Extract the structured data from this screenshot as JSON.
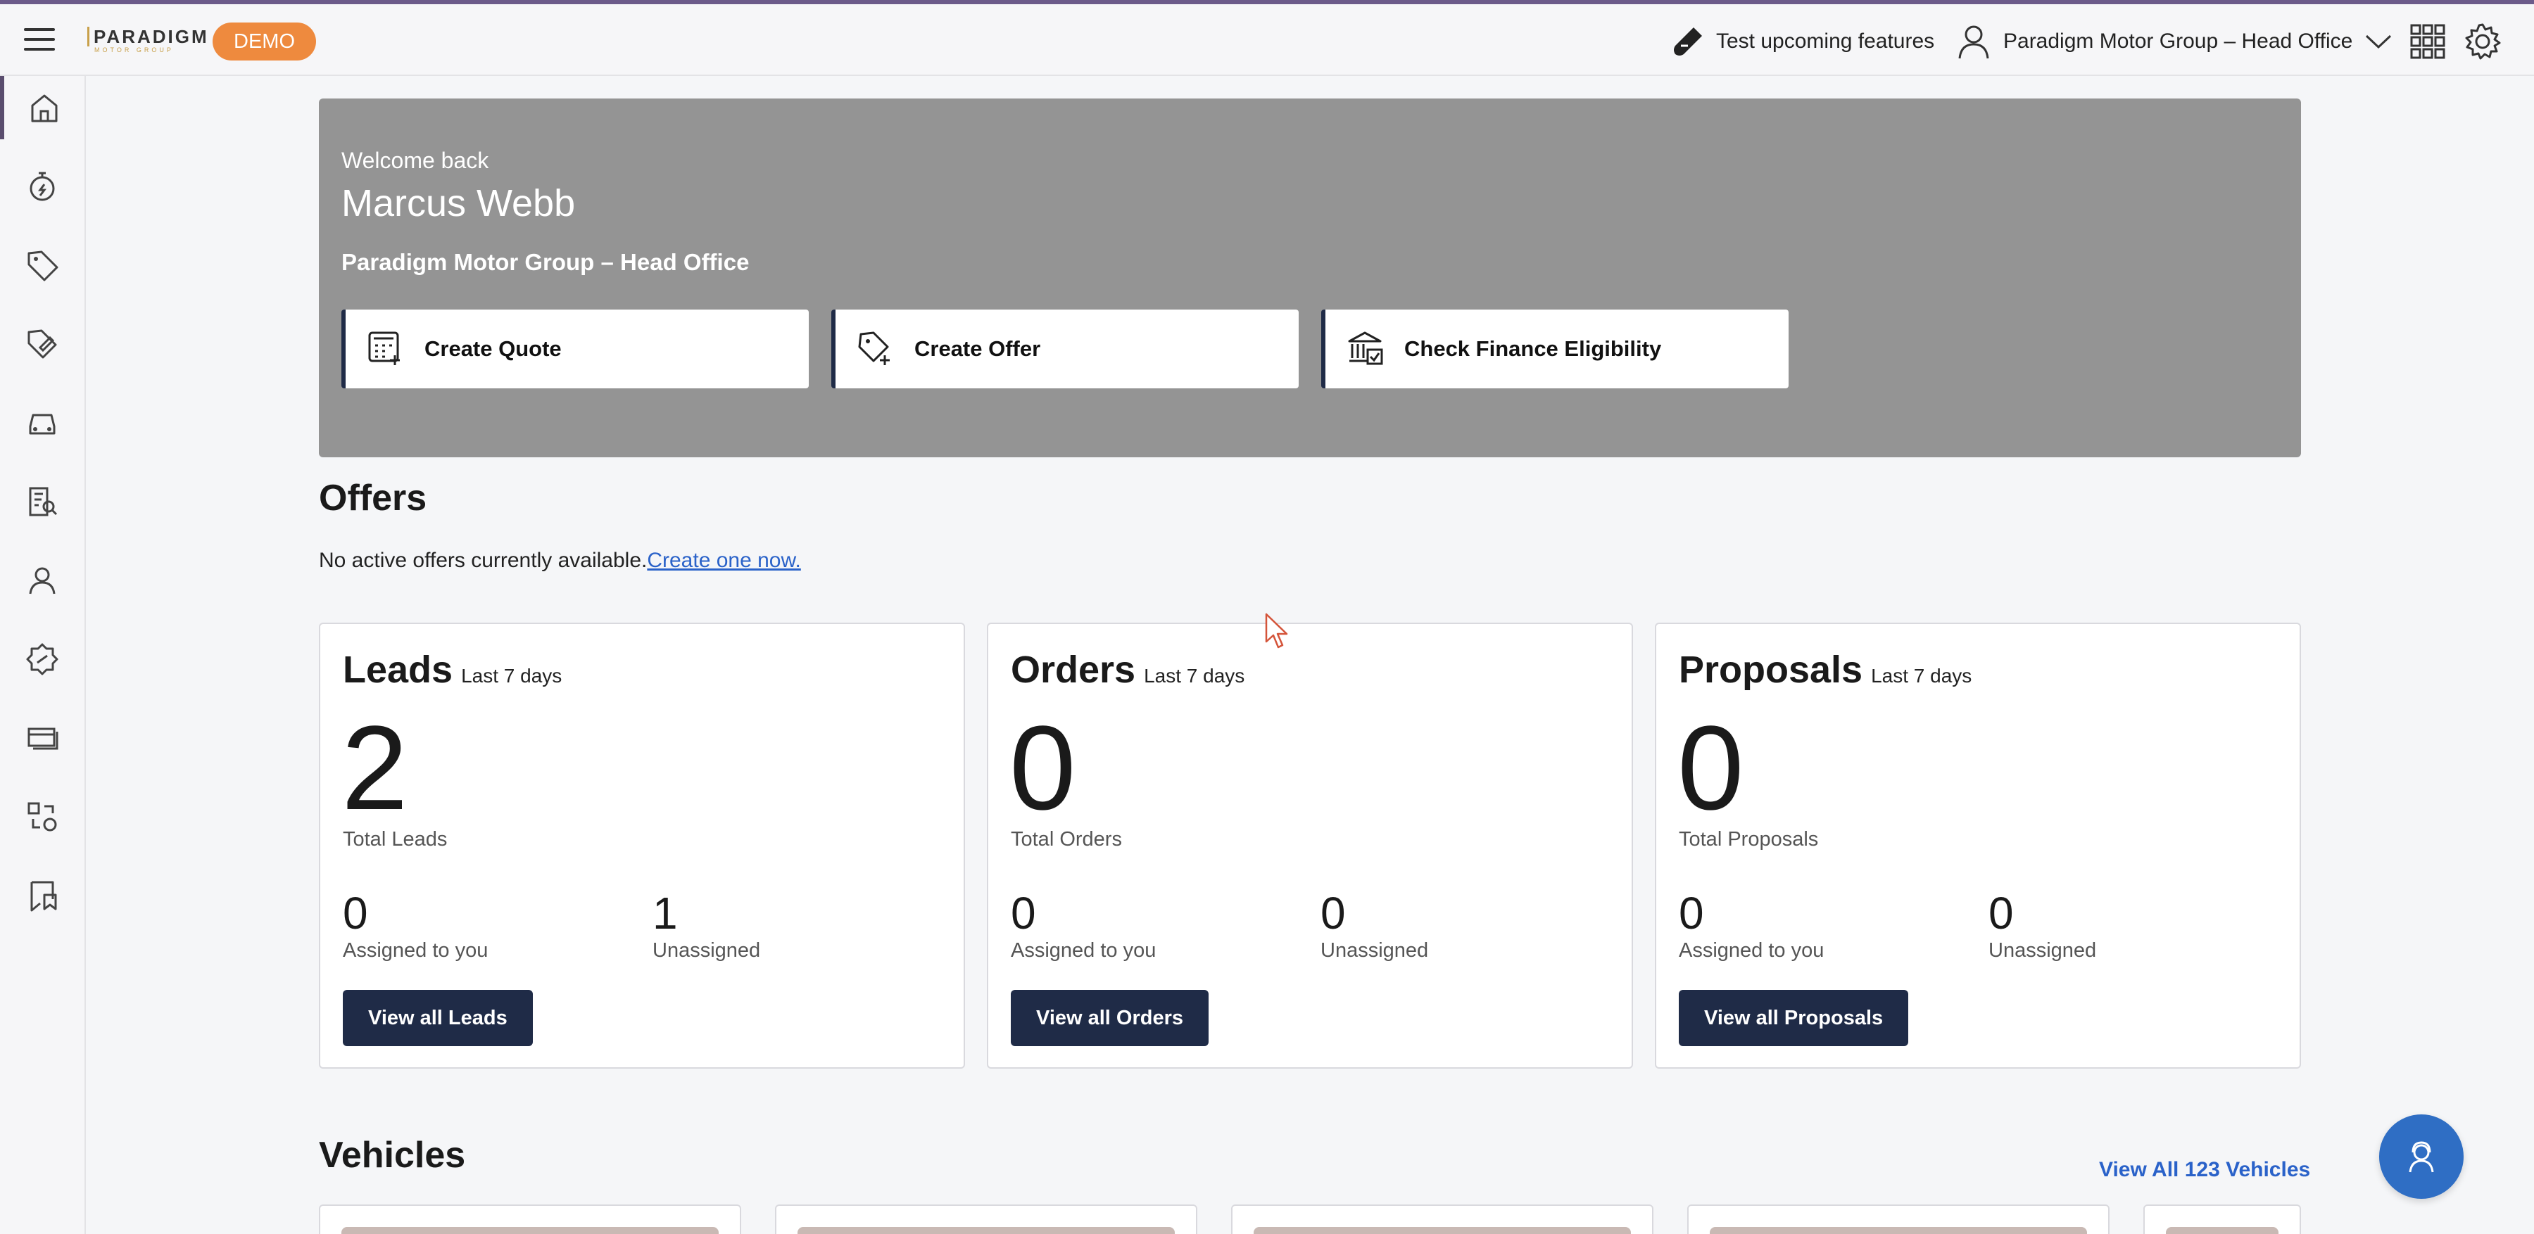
{
  "header": {
    "logo_text": "PARADIGM",
    "logo_subtext": "MOTOR GROUP",
    "demo_badge": "DEMO",
    "test_features": "Test upcoming features",
    "org_name": "Paradigm Motor Group – Head Office"
  },
  "sidebar": {
    "items": [
      {
        "icon": "home-icon"
      },
      {
        "icon": "stopwatch-icon"
      },
      {
        "icon": "tag-icon"
      },
      {
        "icon": "tag-edit-icon"
      },
      {
        "icon": "car-icon"
      },
      {
        "icon": "report-search-icon"
      },
      {
        "icon": "users-icon"
      },
      {
        "icon": "badge-icon"
      },
      {
        "icon": "cards-icon"
      },
      {
        "icon": "swap-icon"
      },
      {
        "icon": "bookmark-icon"
      }
    ]
  },
  "hero": {
    "welcome": "Welcome back",
    "user_name": "Marcus Webb",
    "org_name": "Paradigm Motor Group – Head Office",
    "actions": [
      {
        "label": "Create Quote",
        "icon": "calculator-icon"
      },
      {
        "label": "Create Offer",
        "icon": "tag-add-icon"
      },
      {
        "label": "Check Finance Eligibility",
        "icon": "bank-icon"
      }
    ]
  },
  "offers": {
    "title": "Offers",
    "empty_text": "No active offers currently available.",
    "create_link": "Create one now."
  },
  "stats": [
    {
      "title": "Leads",
      "period": "Last 7 days",
      "total": "2",
      "total_label": "Total Leads",
      "assigned": "0",
      "assigned_label": "Assigned to you",
      "unassigned": "1",
      "unassigned_label": "Unassigned",
      "button": "View all Leads"
    },
    {
      "title": "Orders",
      "period": "Last 7 days",
      "total": "0",
      "total_label": "Total Orders",
      "assigned": "0",
      "assigned_label": "Assigned to you",
      "unassigned": "0",
      "unassigned_label": "Unassigned",
      "button": "View all Orders"
    },
    {
      "title": "Proposals",
      "period": "Last 7 days",
      "total": "0",
      "total_label": "Total Proposals",
      "assigned": "0",
      "assigned_label": "Assigned to you",
      "unassigned": "0",
      "unassigned_label": "Unassigned",
      "button": "View all Proposals"
    }
  ],
  "vehicles": {
    "title": "Vehicles",
    "view_all": "View All 123 Vehicles"
  },
  "colors": {
    "accent": "#1f2b47",
    "link": "#2a62c9",
    "demo": "#ee8a3e",
    "hero_bg": "#949494",
    "fab": "#2f6ec4"
  }
}
